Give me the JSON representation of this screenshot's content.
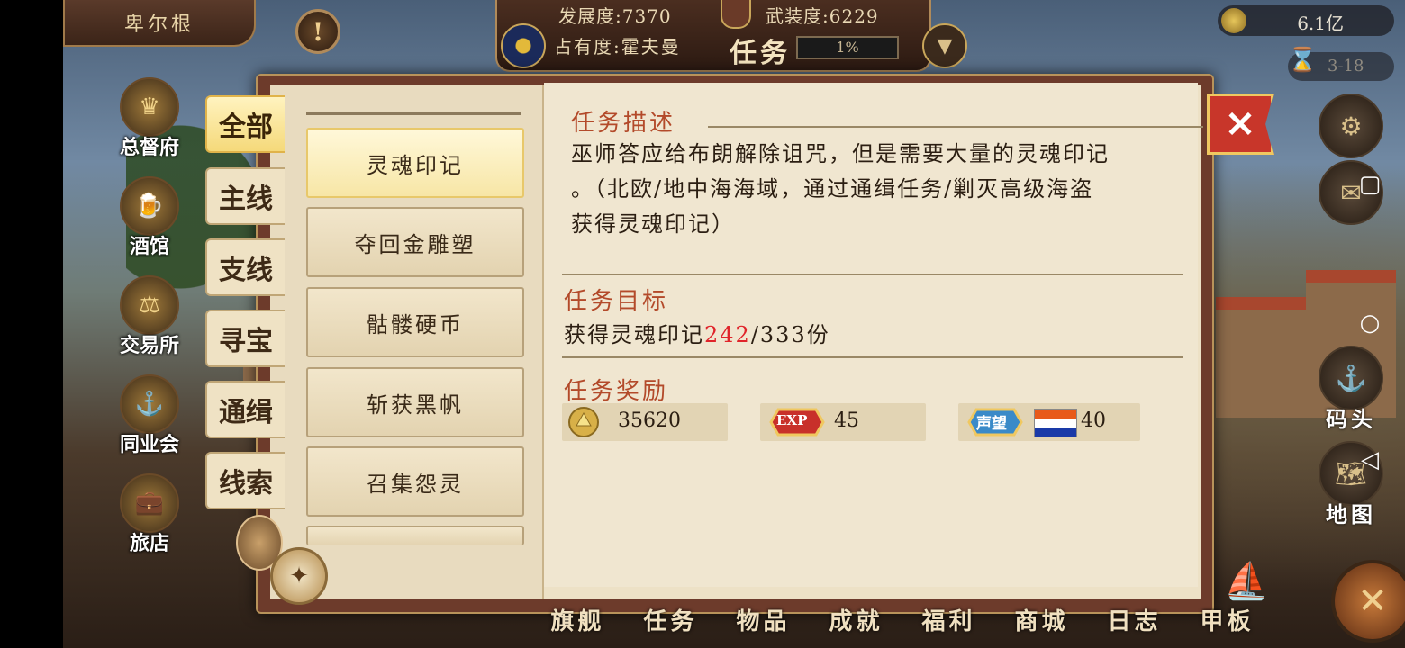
{
  "city": "卑尔根",
  "top": {
    "development_label": "发展度:",
    "development_value": "7370",
    "armament_label": "武装度:",
    "armament_value": "6229",
    "ownership_label": "占有度:",
    "ownership_value": "霍夫曼",
    "title": "任务",
    "progress_text": "1%"
  },
  "currency": {
    "gold": "6.1亿",
    "time": "3-18"
  },
  "left_menu": [
    "总督府",
    "酒馆",
    "交易所",
    "同业会",
    "旅店"
  ],
  "right_menu": [
    "码头",
    "地图"
  ],
  "tabs": [
    "全部",
    "主线",
    "支线",
    "寻宝",
    "通缉",
    "线索"
  ],
  "active_tab": "全部",
  "quests": [
    "灵魂印记",
    "夺回金雕塑",
    "骷髅硬币",
    "斩获黑帆",
    "召集怨灵"
  ],
  "active_quest": "灵魂印记",
  "detail": {
    "desc_heading": "任务描述",
    "desc_lines": [
      "巫师答应给布朗解除诅咒，但是需要大量的灵魂印记",
      "。（北欧/地中海海域，通过通缉任务/剿灭高级海盗",
      "获得灵魂印记）"
    ],
    "target_heading": "任务目标",
    "target_prefix": "获得灵魂印记",
    "target_current": "242",
    "target_suffix": "/333份",
    "reward_heading": "任务奖励",
    "rewards": [
      {
        "icon": "gold-coin-icon",
        "value": "35620"
      },
      {
        "icon": "exp-icon",
        "value": "45",
        "badge": "EXP"
      },
      {
        "icon": "reputation-icon",
        "value": "40",
        "badge": "声望",
        "flag_colors": [
          "#e85a1a",
          "#ffffff",
          "#1a3aa8"
        ]
      }
    ]
  },
  "bottom_nav": [
    "旗舰",
    "任务",
    "物品",
    "成就",
    "福利",
    "商城",
    "日志",
    "甲板"
  ],
  "colors": {
    "accent_red": "#b34a2a",
    "highlight": "#e0242a",
    "panel": "#6d3b2b"
  }
}
